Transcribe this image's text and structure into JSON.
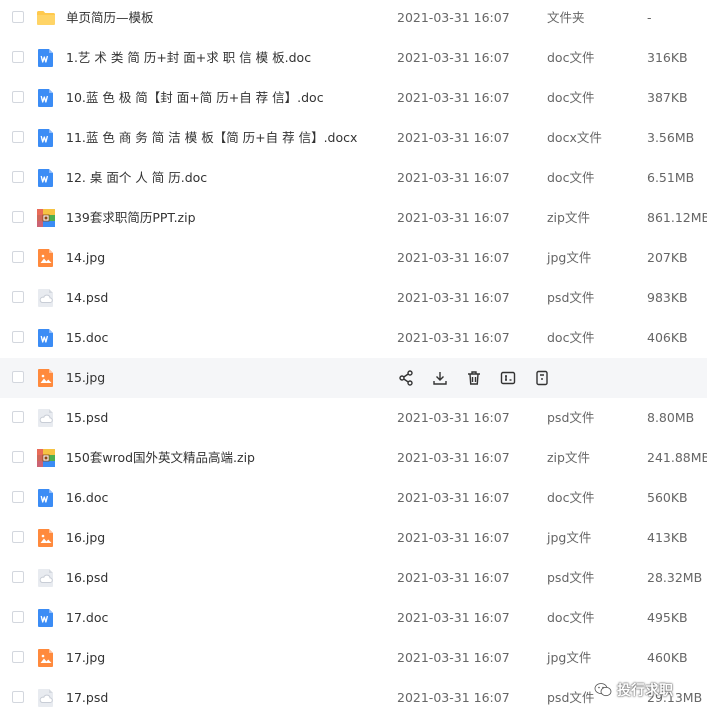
{
  "files": [
    {
      "name": "单页简历—模板",
      "date": "2021-03-31 16:07",
      "type": "文件夹",
      "size": "-",
      "icon": "folder-icon",
      "kind": "folder"
    },
    {
      "name": "1.艺 术 类 简 历+封 面+求 职 信 模 板.doc",
      "date": "2021-03-31 16:07",
      "type": "doc文件",
      "size": "316KB",
      "icon": "word-doc-icon",
      "kind": "doc"
    },
    {
      "name": "10.蓝 色 极 简【封 面+简 历+自 荐 信】.doc",
      "date": "2021-03-31 16:07",
      "type": "doc文件",
      "size": "387KB",
      "icon": "word-doc-icon",
      "kind": "doc"
    },
    {
      "name": "11.蓝 色 商 务 简 洁 模 板【简 历+自 荐 信】.docx",
      "date": "2021-03-31 16:07",
      "type": "docx文件",
      "size": "3.56MB",
      "icon": "word-doc-icon",
      "kind": "doc"
    },
    {
      "name": "12. 桌 面个 人 简 历.doc",
      "date": "2021-03-31 16:07",
      "type": "doc文件",
      "size": "6.51MB",
      "icon": "word-doc-icon",
      "kind": "doc"
    },
    {
      "name": "139套求职简历PPT.zip",
      "date": "2021-03-31 16:07",
      "type": "zip文件",
      "size": "861.12MB",
      "icon": "zip-archive-icon",
      "kind": "zip"
    },
    {
      "name": "14.jpg",
      "date": "2021-03-31 16:07",
      "type": "jpg文件",
      "size": "207KB",
      "icon": "image-file-icon",
      "kind": "img"
    },
    {
      "name": "14.psd",
      "date": "2021-03-31 16:07",
      "type": "psd文件",
      "size": "983KB",
      "icon": "cloud-file-icon",
      "kind": "psd"
    },
    {
      "name": "15.doc",
      "date": "2021-03-31 16:07",
      "type": "doc文件",
      "size": "406KB",
      "icon": "word-doc-icon",
      "kind": "doc"
    },
    {
      "name": "15.jpg",
      "date": "",
      "type": "",
      "size": "",
      "icon": "image-file-icon",
      "kind": "img",
      "hover": true
    },
    {
      "name": "15.psd",
      "date": "2021-03-31 16:07",
      "type": "psd文件",
      "size": "8.80MB",
      "icon": "cloud-file-icon",
      "kind": "psd"
    },
    {
      "name": "150套wrod国外英文精品高端.zip",
      "date": "2021-03-31 16:07",
      "type": "zip文件",
      "size": "241.88MB",
      "icon": "zip-archive-icon",
      "kind": "zip"
    },
    {
      "name": "16.doc",
      "date": "2021-03-31 16:07",
      "type": "doc文件",
      "size": "560KB",
      "icon": "word-doc-icon",
      "kind": "doc"
    },
    {
      "name": "16.jpg",
      "date": "2021-03-31 16:07",
      "type": "jpg文件",
      "size": "413KB",
      "icon": "image-file-icon",
      "kind": "img"
    },
    {
      "name": "16.psd",
      "date": "2021-03-31 16:07",
      "type": "psd文件",
      "size": "28.32MB",
      "icon": "cloud-file-icon",
      "kind": "psd"
    },
    {
      "name": "17.doc",
      "date": "2021-03-31 16:07",
      "type": "doc文件",
      "size": "495KB",
      "icon": "word-doc-icon",
      "kind": "doc"
    },
    {
      "name": "17.jpg",
      "date": "2021-03-31 16:07",
      "type": "jpg文件",
      "size": "460KB",
      "icon": "image-file-icon",
      "kind": "img"
    },
    {
      "name": "17.psd",
      "date": "2021-03-31 16:07",
      "type": "psd文件",
      "size": "29.13MB",
      "icon": "cloud-file-icon",
      "kind": "psd"
    }
  ],
  "hover_actions": [
    {
      "icon": "share-icon"
    },
    {
      "icon": "download-icon"
    },
    {
      "icon": "delete-icon"
    },
    {
      "icon": "rename-icon"
    },
    {
      "icon": "more-icon"
    }
  ],
  "watermark": {
    "text": "投行求职",
    "icon": "wechat-icon"
  },
  "colors": {
    "folder": "#FFC94D",
    "word": "#3B8CF5",
    "image": "#FF8A3D",
    "psd": "#C8CDD6",
    "hover_bg": "#F5F6F8",
    "text": "#333333",
    "meta": "#666666",
    "action_icon": "#333333"
  }
}
